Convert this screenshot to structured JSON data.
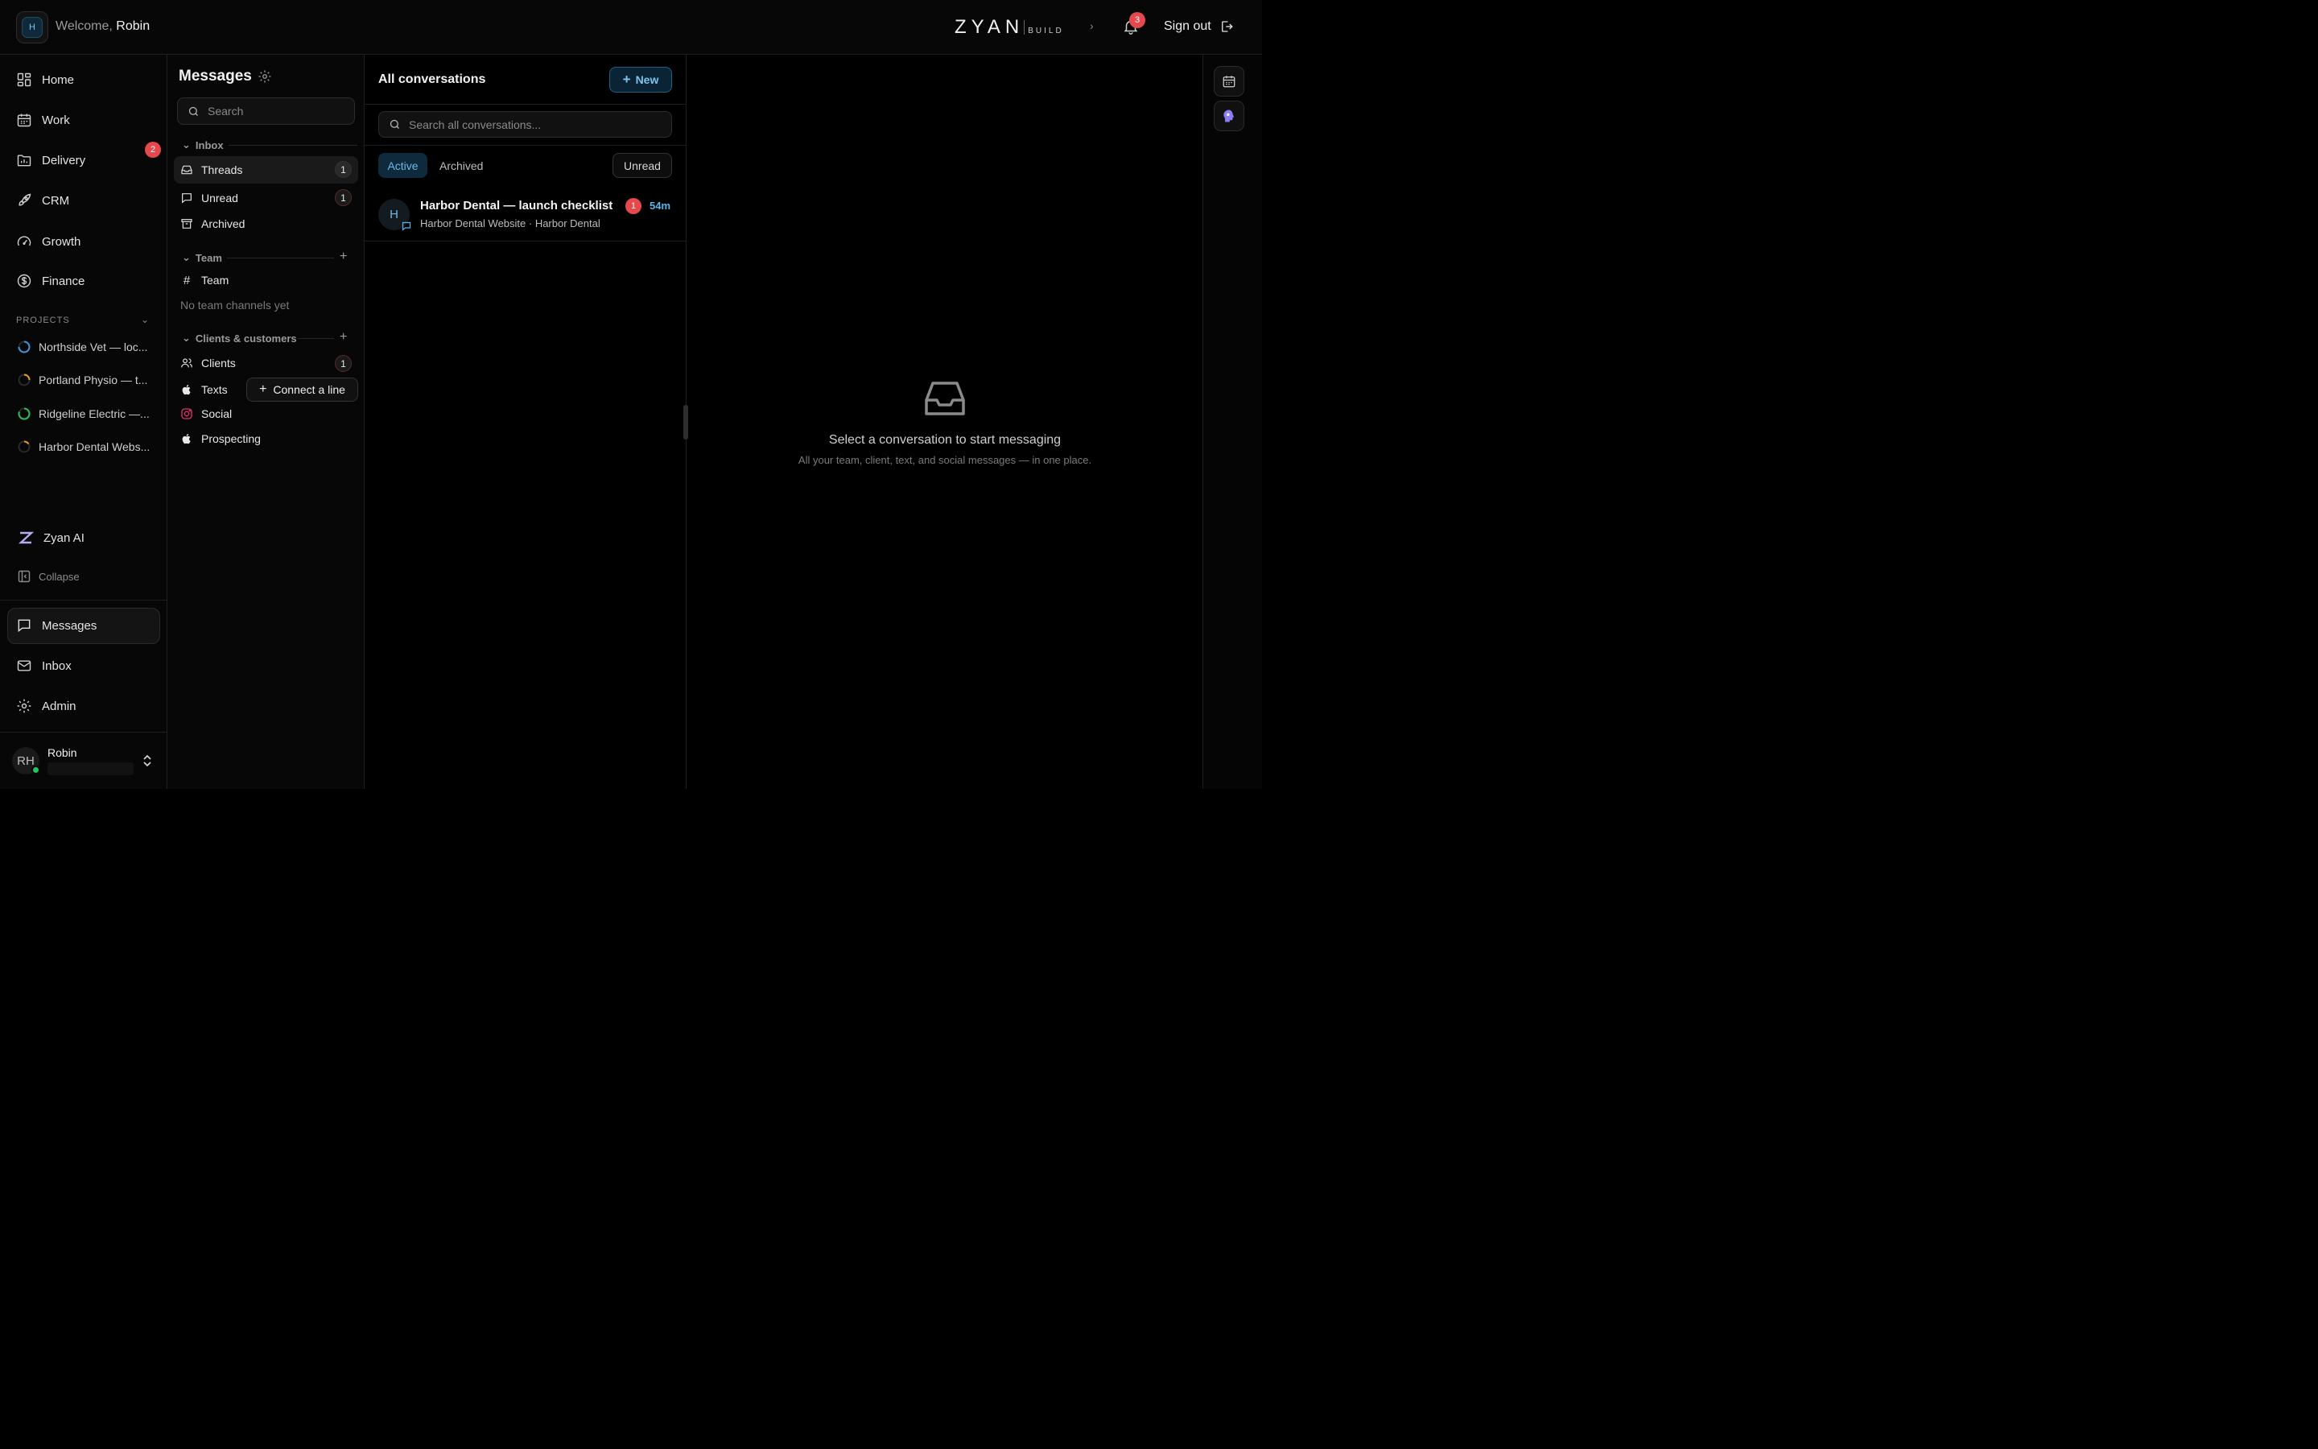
{
  "topbar": {
    "workspace_initial": "H",
    "welcome_prefix": "Welcome,",
    "welcome_name": "Robin",
    "brand_word": "ZYAN",
    "brand_sub": "BUILD",
    "notification_count": "3",
    "sign_out_label": "Sign out"
  },
  "sidebar": {
    "items": [
      {
        "label": "Home",
        "icon": "dashboard-icon"
      },
      {
        "label": "Work",
        "icon": "calendar-icon"
      },
      {
        "label": "Delivery",
        "icon": "folder-chart-icon",
        "badge": "2"
      },
      {
        "label": "CRM",
        "icon": "rocket-icon"
      },
      {
        "label": "Growth",
        "icon": "gauge-icon"
      },
      {
        "label": "Finance",
        "icon": "dollar-icon"
      }
    ],
    "projects_header": "PROJECTS",
    "projects": [
      {
        "name": "Northside Vet — loc...",
        "color": "#3b9ae1"
      },
      {
        "name": "Portland Physio — t...",
        "color": "#f59e0b"
      },
      {
        "name": "Ridgeline Electric —...",
        "color": "#22c55e"
      },
      {
        "name": "Harbor Dental Webs...",
        "color": "#f59e0b"
      }
    ],
    "zyan_ai_label": "Zyan AI",
    "collapse_label": "Collapse",
    "bottom_items": [
      {
        "label": "Messages",
        "icon": "chat-icon",
        "active": true
      },
      {
        "label": "Inbox",
        "icon": "mail-icon"
      },
      {
        "label": "Admin",
        "icon": "gear-icon"
      }
    ],
    "user": {
      "initials": "RH",
      "name": "Robin"
    }
  },
  "messages_panel": {
    "title": "Messages",
    "search_placeholder": "Search",
    "inbox_header": "Inbox",
    "inbox_items": [
      {
        "label": "Threads",
        "count": "1"
      },
      {
        "label": "Unread",
        "count": "1"
      },
      {
        "label": "Archived"
      }
    ],
    "team_header": "Team",
    "team_channel": "Team",
    "team_empty": "No team channels yet",
    "clients_header": "Clients & customers",
    "client_items": [
      {
        "label": "Clients",
        "count": "1"
      },
      {
        "label": "Texts"
      },
      {
        "label": "Social"
      },
      {
        "label": "Prospecting"
      }
    ],
    "connect_label": "Connect a line"
  },
  "conversations": {
    "title": "All conversations",
    "new_label": "New",
    "search_placeholder": "Search all conversations...",
    "tabs": {
      "active": "Active",
      "archived": "Archived",
      "unread": "Unread"
    },
    "items": [
      {
        "avatar": "H",
        "name": "Harbor Dental — launch checklist",
        "meta": "Harbor Dental Website · Harbor Dental",
        "unread": "1",
        "time": "54m"
      }
    ]
  },
  "empty_state": {
    "title": "Select a conversation to start messaging",
    "subtitle": "All your team, client, text, and social messages — in one place."
  },
  "colors": {
    "accent": "#5fb3e6",
    "badge_red": "#e5484d",
    "online": "#22c55e"
  }
}
